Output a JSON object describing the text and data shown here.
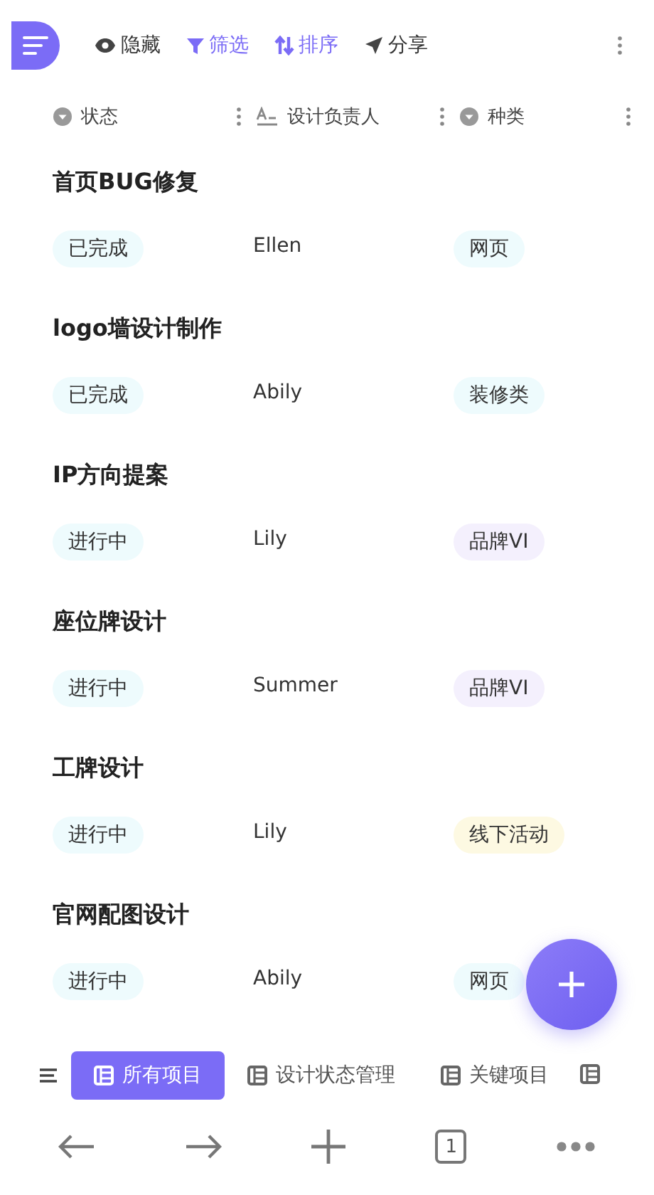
{
  "toolbar": {
    "actions": [
      {
        "label": "隐藏",
        "kind": "hide",
        "active": false
      },
      {
        "label": "筛选",
        "kind": "filter",
        "active": true
      },
      {
        "label": "排序",
        "kind": "sort",
        "active": true
      },
      {
        "label": "分享",
        "kind": "share",
        "active": false
      }
    ]
  },
  "columns": [
    {
      "label": "状态",
      "kind": "select"
    },
    {
      "label": "设计负责人",
      "kind": "text"
    },
    {
      "label": "种类",
      "kind": "select"
    }
  ],
  "records": [
    {
      "title": "首页BUG修复",
      "status": {
        "label": "已完成",
        "color": "#eefbfd"
      },
      "owner": "Ellen",
      "type": {
        "label": "网页",
        "color": "#eefbfd"
      }
    },
    {
      "title": "logo墙设计制作",
      "status": {
        "label": "已完成",
        "color": "#eefbfd"
      },
      "owner": "Abily",
      "type": {
        "label": "装修类",
        "color": "#eefbfd"
      }
    },
    {
      "title": "IP方向提案",
      "status": {
        "label": "进行中",
        "color": "#eefbfd"
      },
      "owner": "Lily",
      "type": {
        "label": "品牌VI",
        "color": "#f4f0fd"
      }
    },
    {
      "title": "座位牌设计",
      "status": {
        "label": "进行中",
        "color": "#eefbfd"
      },
      "owner": "Summer",
      "type": {
        "label": "品牌VI",
        "color": "#f4f0fd"
      }
    },
    {
      "title": "工牌设计",
      "status": {
        "label": "进行中",
        "color": "#eefbfd"
      },
      "owner": "Lily",
      "type": {
        "label": "线下活动",
        "color": "#fdf9e2"
      }
    },
    {
      "title": "官网配图设计",
      "status": {
        "label": "进行中",
        "color": "#eefbfd"
      },
      "owner": "Abily",
      "type": {
        "label": "网页",
        "color": "#eefbfd"
      }
    }
  ],
  "views": [
    {
      "label": "所有项目",
      "selected": true
    },
    {
      "label": "设计状态管理",
      "selected": false
    },
    {
      "label": "关键项目",
      "selected": false
    }
  ],
  "browser_bar": {
    "tab_count": "1"
  }
}
